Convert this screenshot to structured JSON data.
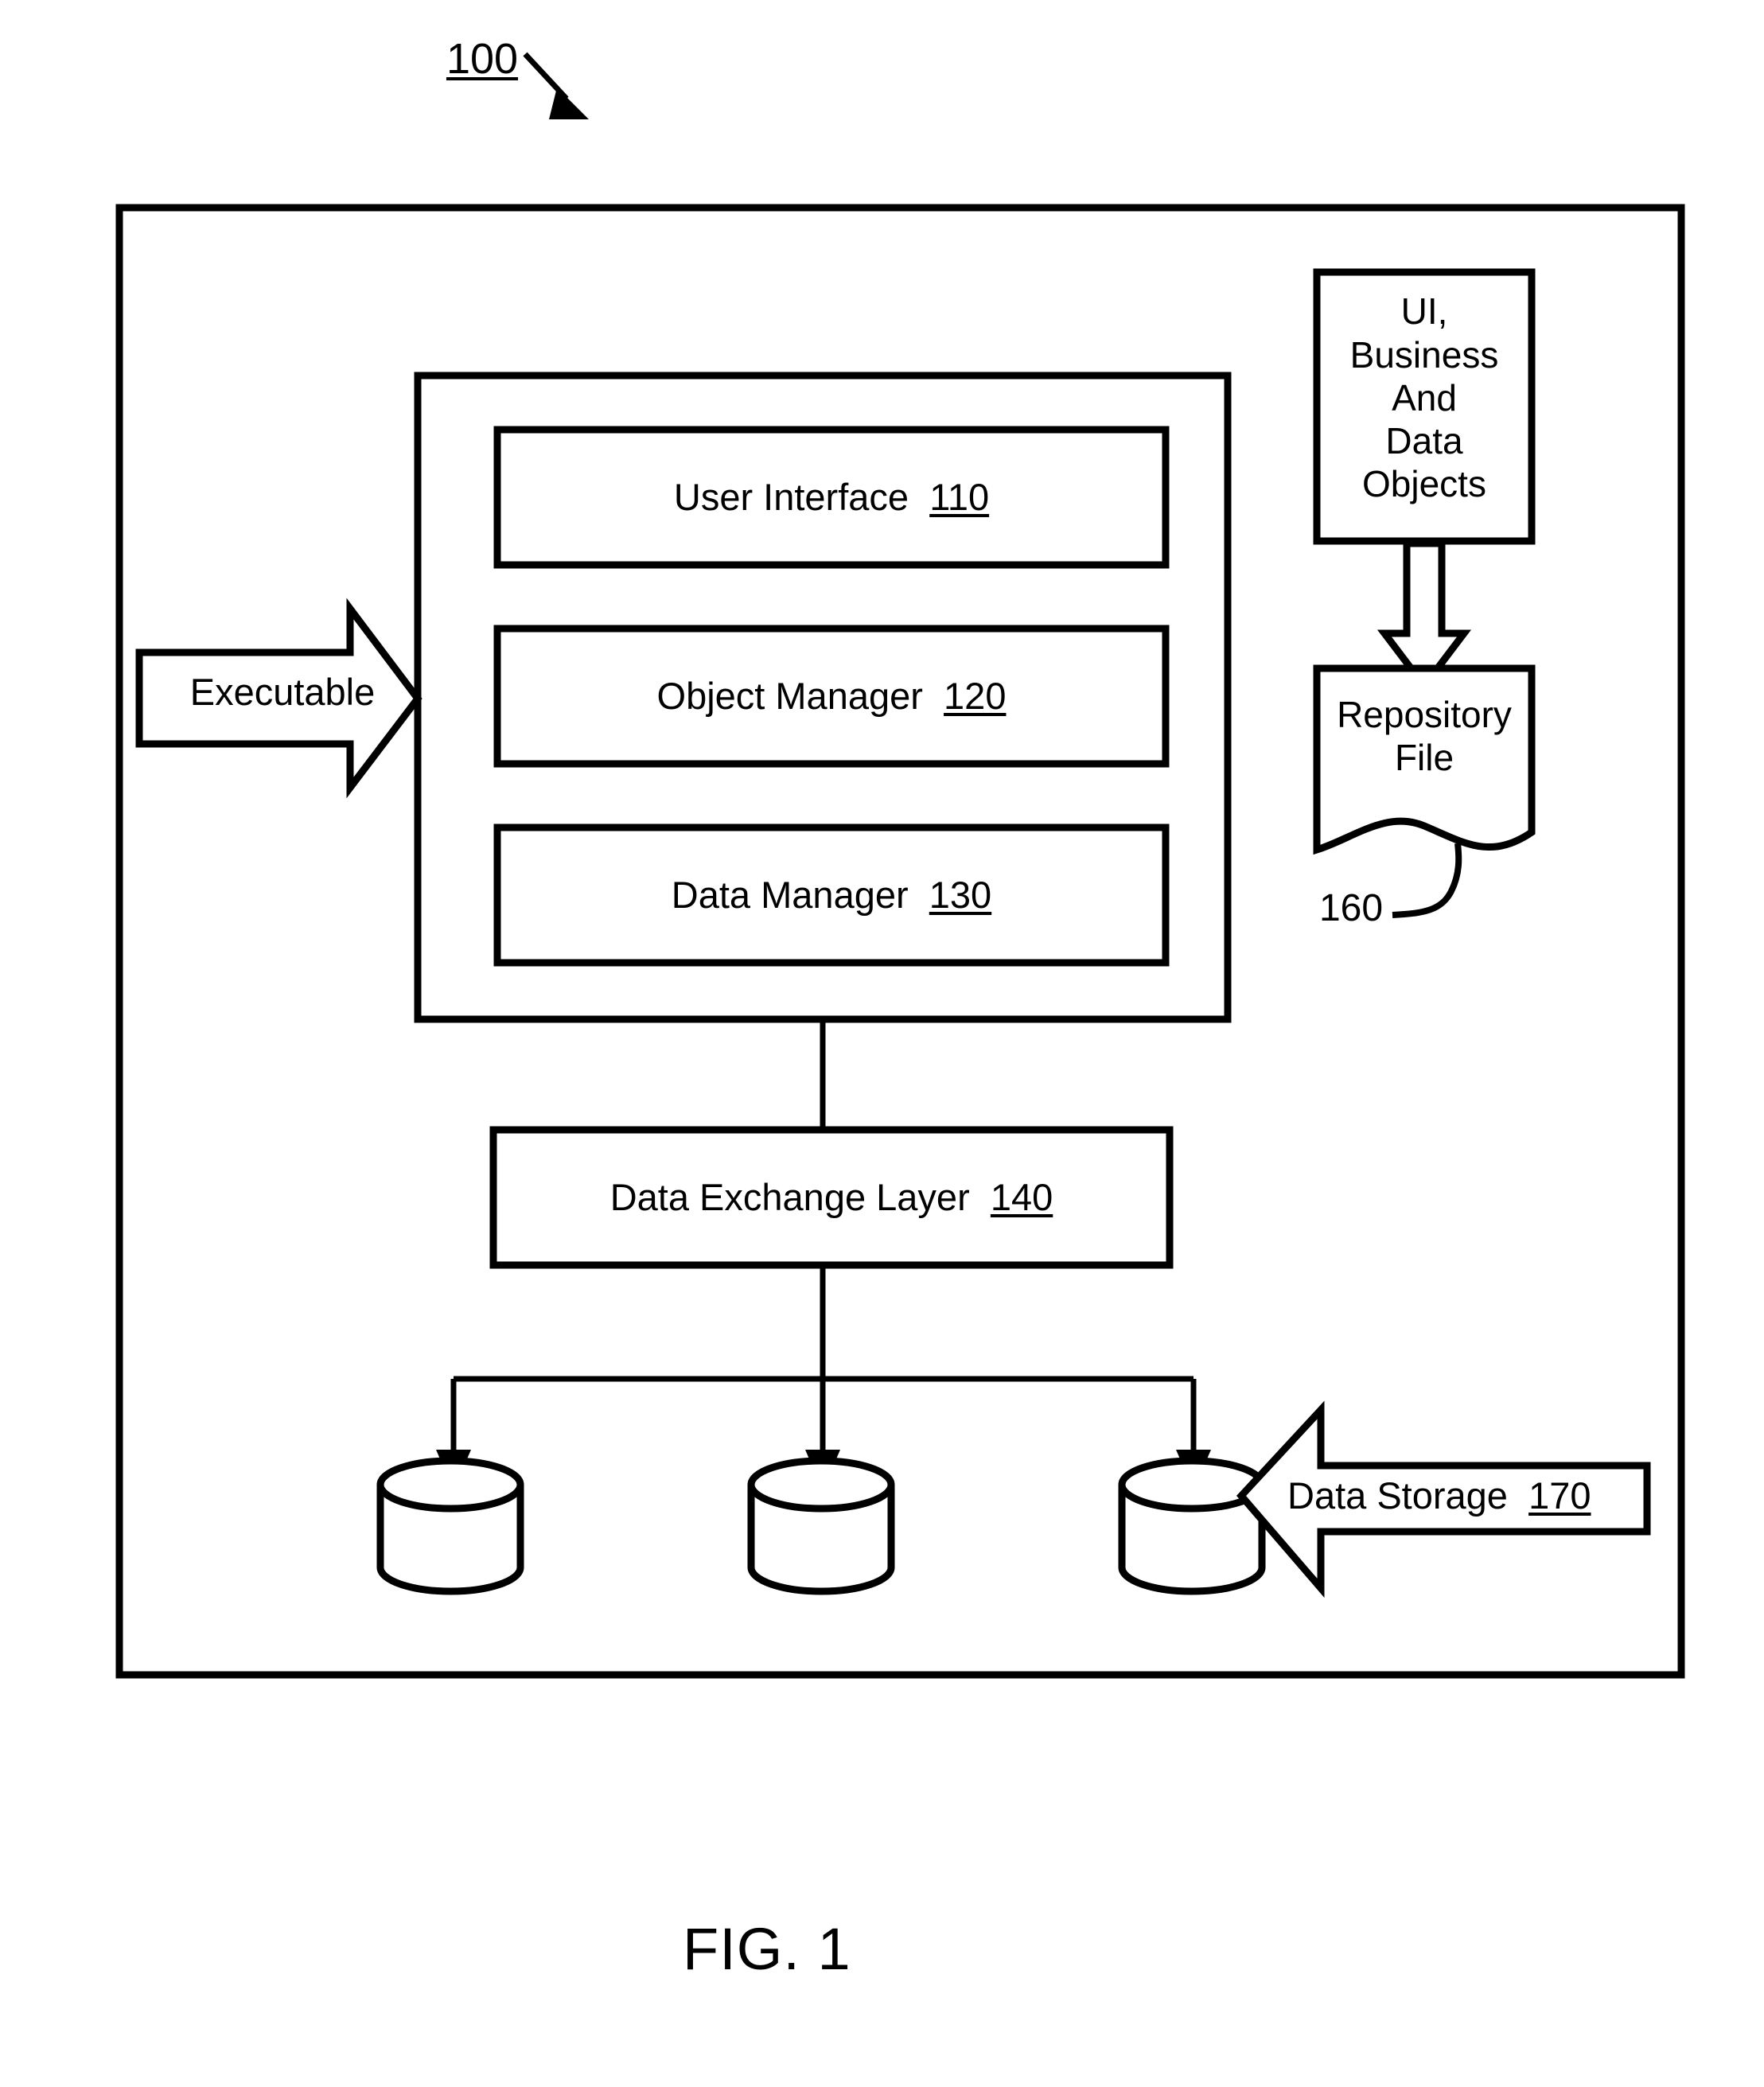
{
  "figure": {
    "caption": "FIG. 1",
    "system_ref": "100",
    "title_text": "FIG. 1"
  },
  "diagram": {
    "type": "block-diagram",
    "orientation": "top-down",
    "system_label": {
      "text": "100",
      "underlined": true,
      "pointer": "arrow-to-system-boundary"
    },
    "boundary": {
      "name": "system-boundary",
      "stroke": "#000000"
    },
    "application_container": {
      "name": "application-container",
      "components": [
        {
          "label": "User Interface",
          "ref": "110",
          "name": "user-interface-block"
        },
        {
          "label": "Object Manager",
          "ref": "120",
          "name": "object-manager-block"
        },
        {
          "label": "Data Manager",
          "ref": "130",
          "name": "data-manager-block"
        }
      ]
    },
    "data_exchange_layer": {
      "label": "Data Exchange Layer",
      "ref": "140",
      "name": "data-exchange-layer-block"
    },
    "executable_input": {
      "label": "Executable",
      "shape": "right-block-arrow",
      "target": "application-container"
    },
    "objects_source": {
      "lines": [
        "UI,",
        "Business",
        "And",
        "Data",
        "Objects"
      ],
      "text": "UI,\nBusiness\nAnd\nData\nObjects",
      "shape": "rectangle"
    },
    "repository_file": {
      "lines": [
        "Repository",
        "File"
      ],
      "text": "Repository\nFile",
      "ref": "160",
      "shape": "document-wavy-bottom"
    },
    "data_storage_callout": {
      "label": "Data Storage",
      "ref": "170",
      "shape": "left-block-arrow",
      "points_to": "third-data-store-cylinder"
    },
    "data_stores": [
      {
        "name": "data-store-cylinder-1"
      },
      {
        "name": "data-store-cylinder-2"
      },
      {
        "name": "data-store-cylinder-3"
      }
    ],
    "connectors": [
      {
        "from": "application-container",
        "to": "data-exchange-layer-block",
        "style": "plain-line"
      },
      {
        "from": "data-exchange-layer-block",
        "to": "data-store-bus",
        "style": "plain-line"
      },
      {
        "from": "data-store-bus",
        "to": "data-store-cylinder-1",
        "style": "arrow-down"
      },
      {
        "from": "data-store-bus",
        "to": "data-store-cylinder-2",
        "style": "arrow-down"
      },
      {
        "from": "data-store-bus",
        "to": "data-store-cylinder-3",
        "style": "arrow-down"
      },
      {
        "from": "objects-source-box",
        "to": "repository-file",
        "style": "hollow-block-arrow-down"
      }
    ],
    "colors": {
      "stroke": "#000000",
      "fill": "#ffffff",
      "background": "#ffffff"
    }
  }
}
